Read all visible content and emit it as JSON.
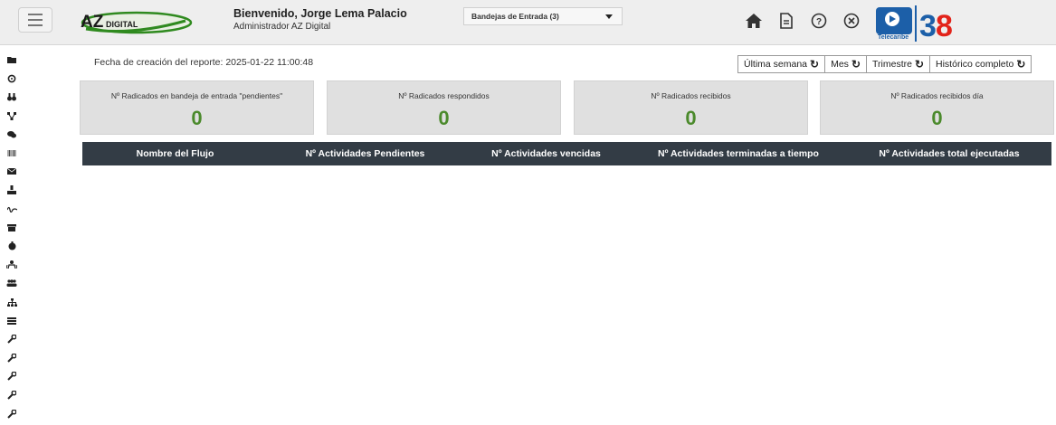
{
  "header": {
    "logo_text": "AZDIGITAL",
    "welcome": "Bienvenido, Jorge Lema Palacio",
    "role": "Administrador AZ Digital",
    "inbox_select": "Bandejas de Entrada (3)",
    "icons": [
      "home-icon",
      "document-icon",
      "help-icon",
      "close-circle-icon"
    ],
    "brand_text": "Telecaribe",
    "brand_subtext": "#UnidosXLaRegión",
    "brand_number": "38",
    "brand_years": "Años"
  },
  "sidebar": {
    "icons": [
      "folder-icon",
      "refresh-icon",
      "binoculars-icon",
      "flow-icon",
      "comments-icon",
      "barcode-icon",
      "envelope-icon",
      "user-upload-icon",
      "signature-icon",
      "archive-icon",
      "bell-icon",
      "user-group-icon",
      "users-icon",
      "sitemap-icon",
      "list-icon",
      "wrench-icon",
      "wrench-icon",
      "wrench-icon",
      "wrench-icon",
      "wrench-icon"
    ]
  },
  "report": {
    "date_label": "Fecha de creación del reporte: 2025-01-22 11:00:48"
  },
  "filters": [
    {
      "label": "Última semana"
    },
    {
      "label": "Mes"
    },
    {
      "label": "Trimestre"
    },
    {
      "label": "Histórico completo"
    }
  ],
  "cards": [
    {
      "label": "Nº Radicados en bandeja de entrada \"pendientes\"",
      "value": "0"
    },
    {
      "label": "Nº Radicados respondidos",
      "value": "0"
    },
    {
      "label": "Nº Radicados recibidos",
      "value": "0"
    },
    {
      "label": "Nº Radicados recibidos día",
      "value": "0"
    }
  ],
  "table": {
    "headers": [
      "Nombre del Flujo",
      "Nº Actividades Pendientes",
      "Nº Actividades vencidas",
      "Nº Actividades terminadas a tiempo",
      "Nº Actividades total ejecutadas"
    ],
    "rows": []
  },
  "colors": {
    "header_bg": "#eeeeee",
    "card_bg": "#e0e0e0",
    "value_green": "#4b8a2c",
    "table_head_bg": "#333c45",
    "logo_green": "#2f8a1f"
  }
}
